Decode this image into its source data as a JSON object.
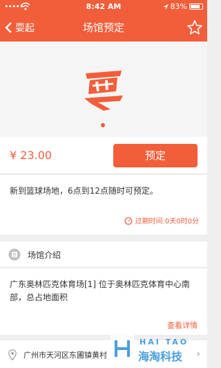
{
  "status_bar": {
    "time": "8:42 AM",
    "battery": "83%",
    "battery_level": 0.83
  },
  "nav": {
    "back_label": "耍起",
    "title": "场馆预定"
  },
  "product": {
    "price": "¥ 23.00",
    "book_label": "预定"
  },
  "notice": {
    "text": "新到篮球场地，6点到12点随时可预定。",
    "expire": "过期时间:0天0时0分"
  },
  "venue": {
    "section_title": "场馆介绍",
    "description": "广东奥林匹克体育场[1] 位于奥林匹克体育中心南部，总占地面积",
    "details_link": "查看详情"
  },
  "address": {
    "text": "广州市天河区东圃镇黄村"
  },
  "watermark": {
    "top": "HAI TAO",
    "bottom": "海淘科技"
  },
  "colors": {
    "accent": "#f25d3a"
  }
}
